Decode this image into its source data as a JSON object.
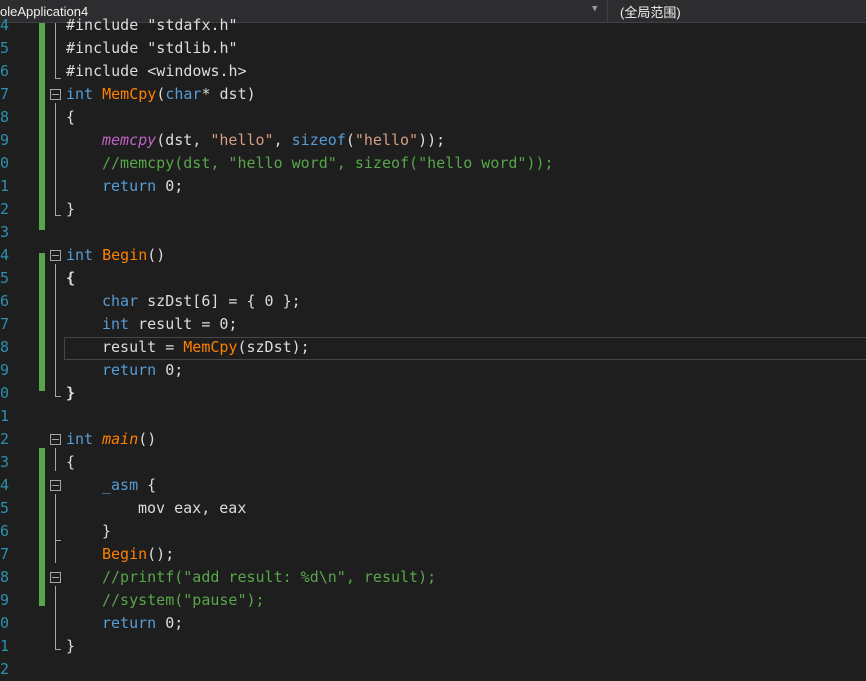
{
  "toolbar": {
    "project_label": "oleApplication4",
    "scope_label": "(全局范围)"
  },
  "line_numbers": [
    "4",
    "5",
    "6",
    "7",
    "8",
    "9",
    "0",
    "1",
    "2",
    "3",
    "4",
    "5",
    "6",
    "7",
    "8",
    "9",
    "0",
    "1",
    "2",
    "3",
    "4",
    "5",
    "6",
    "7",
    "8",
    "9",
    "0",
    "1",
    "2"
  ],
  "code": {
    "l0": "#include \"stdafx.h\"",
    "l1": "#include \"stdlib.h\"",
    "l2": "#include <windows.h>",
    "l3": {
      "t1": "int",
      "t2": "MemCpy",
      "t3": "(",
      "t4": "char",
      "t5": "* dst)"
    },
    "l4": "{",
    "l5": {
      "t1": "memcpy",
      "t2": "(dst, ",
      "t3": "\"hello\"",
      "t4": ", ",
      "t5": "sizeof",
      "t6": "(",
      "t7": "\"hello\"",
      "t8": "));"
    },
    "l6": "//memcpy(dst, \"hello word\", sizeof(\"hello word\"));",
    "l7": {
      "t1": "return",
      "t2": " 0;"
    },
    "l8": "}",
    "l10": {
      "t1": "int",
      "t2": "Begin",
      "t3": "()"
    },
    "l11": "{",
    "l12": {
      "t1": "char",
      "t2": " szDst[6] = { 0 };"
    },
    "l13": {
      "t1": "int",
      "t2": " result = 0;"
    },
    "l14": {
      "t1": "result = ",
      "t2": "MemCpy",
      "t3": "(szDst);"
    },
    "l15": {
      "t1": "return",
      "t2": " 0;"
    },
    "l16": "}",
    "l18": {
      "t1": "int",
      "t2": "main",
      "t3": "()"
    },
    "l19": "{",
    "l20": {
      "t1": "_asm",
      "t2": " {"
    },
    "l21": "mov eax, eax",
    "l22": "}",
    "l23": {
      "t1": "Begin",
      "t2": "();"
    },
    "l24": "//printf(\"add result: %d\\n\", result);",
    "l25": "//system(\"pause\");",
    "l26": {
      "t1": "return",
      "t2": " 0;"
    },
    "l27": "}"
  },
  "colors": {
    "background": "#1e1e1e",
    "keyword": "#569cd6",
    "function": "#ff8000",
    "macro": "#bd63c5",
    "string": "#d69d85",
    "comment": "#57a64a",
    "line_number": "#2b91af",
    "change_bar": "#57a64a"
  }
}
